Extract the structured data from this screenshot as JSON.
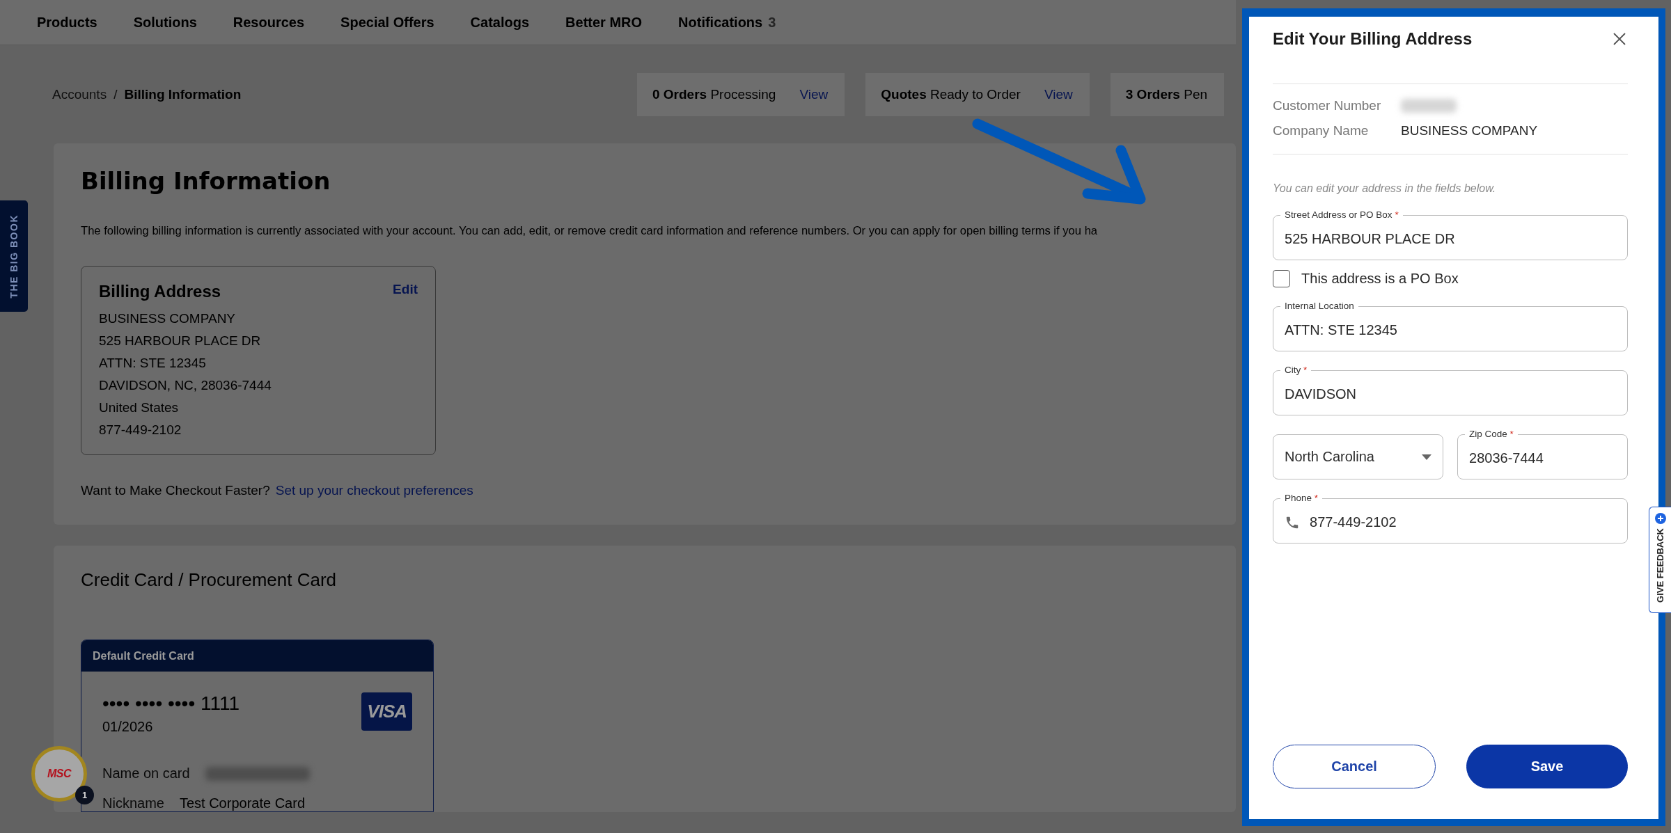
{
  "nav": {
    "items": [
      {
        "label": "Products"
      },
      {
        "label": "Solutions"
      },
      {
        "label": "Resources"
      },
      {
        "label": "Special Offers"
      },
      {
        "label": "Catalogs"
      },
      {
        "label": "Better MRO"
      },
      {
        "label": "Notifications",
        "count": "3"
      }
    ]
  },
  "breadcrumb": {
    "items": [
      "Accounts",
      "Billing Information"
    ],
    "separator": "/"
  },
  "order_chips": [
    {
      "count": "0 Orders",
      "label": "Processing",
      "link": "View"
    },
    {
      "count": "Quotes",
      "label": "Ready to Order",
      "link": "View"
    },
    {
      "count": "3 Orders",
      "label": "Pen"
    }
  ],
  "side_tab": {
    "label": "THE BIG BOOK"
  },
  "billing": {
    "title": "Billing Information",
    "description": "The following billing information is currently associated with your account. You can add, edit, or remove credit card information and reference numbers. Or you can apply for open billing terms if you ha",
    "address_card": {
      "title": "Billing Address",
      "edit": "Edit",
      "lines": [
        "BUSINESS COMPANY",
        "525 HARBOUR PLACE DR",
        "ATTN: STE 12345",
        "DAVIDSON, NC, 28036-7444",
        "United States",
        "877-449-2102"
      ]
    },
    "checkout_prompt": "Want to Make Checkout Faster?",
    "checkout_link": "Set up your checkout preferences"
  },
  "credit_cards": {
    "title": "Credit Card / Procurement Card",
    "card": {
      "header": "Default Credit Card",
      "number_mask": "•••• •••• ••••",
      "last4": "1111",
      "expiry": "01/2026",
      "brand": "VISA",
      "fields": [
        {
          "label": "Name on card",
          "value_hidden": true
        },
        {
          "label": "Nickname",
          "value": "Test Corporate Card"
        }
      ]
    }
  },
  "chat_badge": {
    "logo": "MSC",
    "count": "1"
  },
  "dialog": {
    "title": "Edit Your Billing Address",
    "info": [
      {
        "label": "Customer Number",
        "value_hidden": true
      },
      {
        "label": "Company Name",
        "value": "BUSINESS COMPANY"
      }
    ],
    "hint": "You can edit your address in the fields below.",
    "required_mark": "*",
    "rows": [
      [
        {
          "kind": "text",
          "label": "Street Address or PO Box",
          "required": true,
          "value": "525 HARBOUR PLACE DR"
        }
      ],
      [
        {
          "kind": "checkbox",
          "label": "This address is a PO Box",
          "checked": false
        }
      ],
      [
        {
          "kind": "text",
          "label": "Internal Location",
          "required": false,
          "value": "ATTN: STE 12345"
        }
      ],
      [
        {
          "kind": "text",
          "label": "City",
          "required": true,
          "value": "DAVIDSON"
        }
      ],
      [
        {
          "kind": "select",
          "value": "North Carolina"
        },
        {
          "kind": "text",
          "label": "Zip Code",
          "required": true,
          "value": "28036-7444"
        }
      ],
      [
        {
          "kind": "phone",
          "label": "Phone",
          "required": true,
          "value": "877-449-2102"
        }
      ]
    ],
    "buttons": [
      {
        "kind": "secondary",
        "label": "Cancel"
      },
      {
        "kind": "primary",
        "label": "Save"
      }
    ]
  },
  "feedback_tab": {
    "label": "GIVE FEEDBACK"
  }
}
